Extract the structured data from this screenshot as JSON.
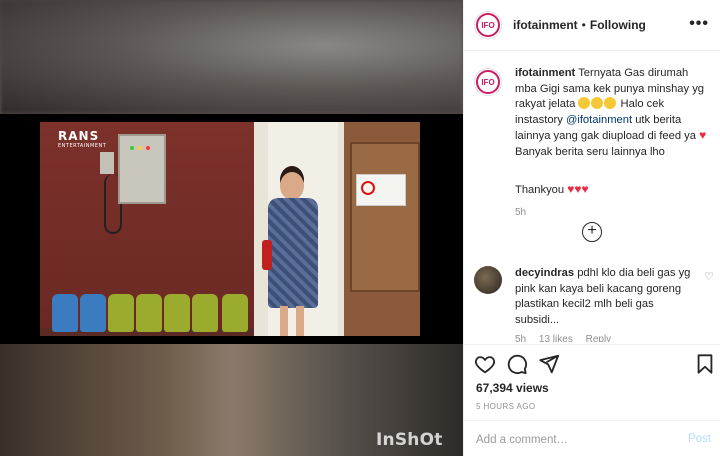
{
  "media": {
    "watermark": "InShOt",
    "channel_logo": "RANS",
    "channel_logo_sub": "ENTERTAINMENT"
  },
  "header": {
    "username": "ifotainment",
    "separator": "•",
    "follow_state": "Following",
    "more_icon": "more-horizontal-icon"
  },
  "caption": {
    "username": "ifotainment",
    "text_1": "Ternyata Gas dirumah mba Gigi sama kek punya minshay yg rakyat jelata",
    "text_2": "Halo cek instastory",
    "mention": "@ifotainment",
    "text_3": "utk berita lainnya yang gak diupload di feed ya",
    "text_4": "Banyak berita seru lainnya lho",
    "thanks": "Thankyou",
    "time": "5h"
  },
  "comment": {
    "username": "decyindras",
    "text": "pdhl klo dia beli gas yg pink kan kaya beli kacang goreng plastikan kecil2 mlh beli gas subsidi...",
    "time": "5h",
    "likes": "13 likes",
    "reply": "Reply"
  },
  "actions": {
    "views": "67,394 views",
    "posted": "5 HOURS AGO"
  },
  "add_comment": {
    "placeholder": "Add a comment…",
    "post_label": "Post"
  },
  "colors": {
    "accent_heart": "#ed2b42",
    "link": "#00376b",
    "post_disabled": "#b3dbff",
    "brand_ring": "#c81d62"
  }
}
